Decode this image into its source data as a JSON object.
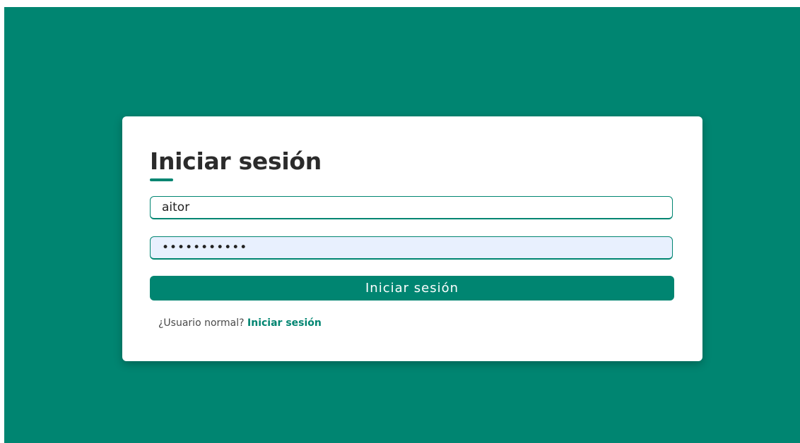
{
  "colors": {
    "brand": "#008571",
    "card_background": "#ffffff",
    "autofill_background": "#e8f0fe",
    "title_text": "#2b2b2b"
  },
  "login": {
    "title": "Iniciar sesión",
    "username_value": "aitor",
    "password_value": "aitor123456",
    "submit_label": "Iniciar sesión",
    "alt_prompt": "¿Usuario normal?",
    "alt_link_label": "Iniciar sesión"
  }
}
